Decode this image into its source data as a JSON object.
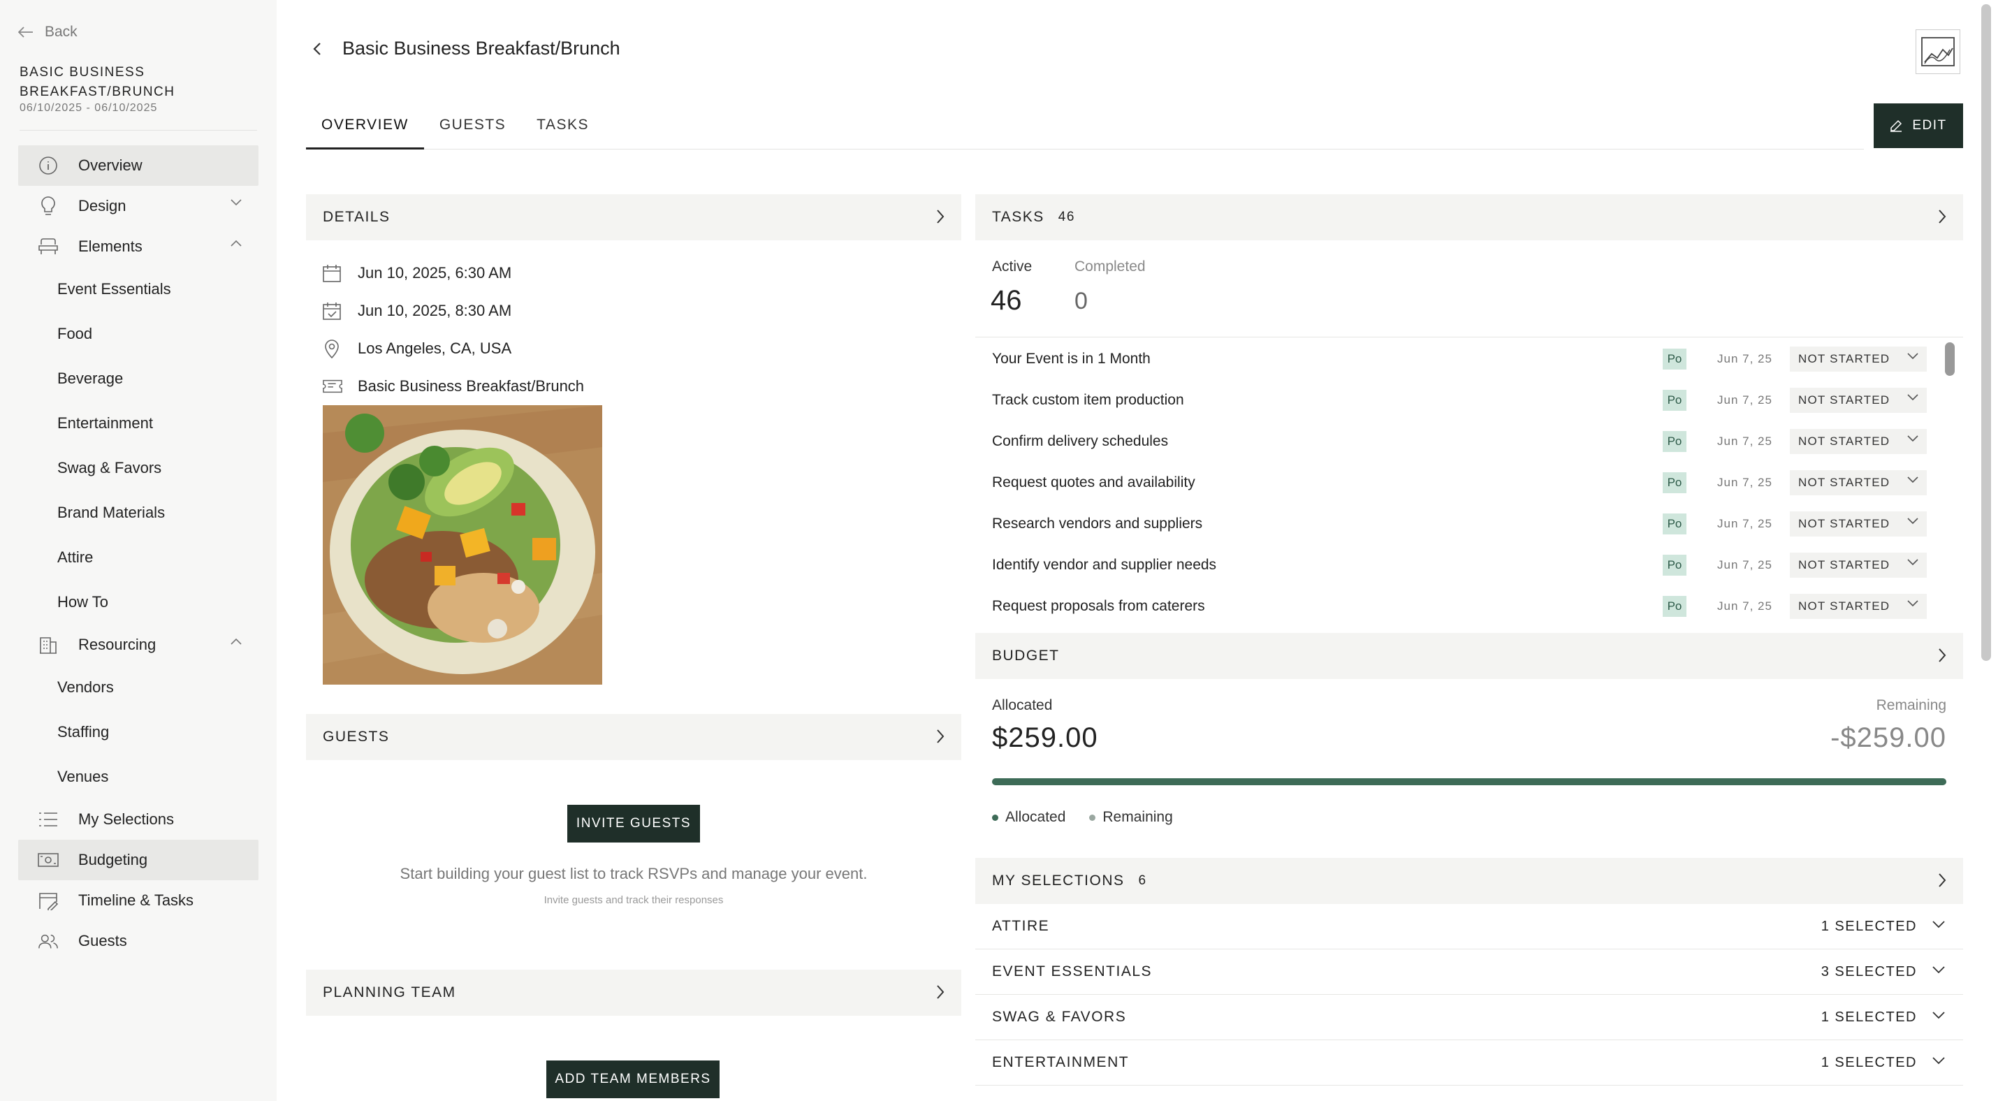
{
  "sidebar": {
    "back_label": "Back",
    "event_title": "BASIC BUSINESS BREAKFAST/BRUNCH",
    "event_dates": "06/10/2025 - 06/10/2025",
    "nav": {
      "overview": "Overview",
      "design": "Design",
      "elements": "Elements",
      "elements_sub": [
        "Event Essentials",
        "Food",
        "Beverage",
        "Entertainment",
        "Swag & Favors",
        "Brand Materials",
        "Attire",
        "How To"
      ],
      "resourcing": "Resourcing",
      "resourcing_sub": [
        "Vendors",
        "Staffing",
        "Venues"
      ],
      "my_selections": "My Selections",
      "budgeting": "Budgeting",
      "timeline": "Timeline & Tasks",
      "guests": "Guests"
    }
  },
  "header": {
    "title": "Basic Business Breakfast/Brunch",
    "tabs": [
      "OVERVIEW",
      "GUESTS",
      "TASKS"
    ],
    "edit_label": "EDIT"
  },
  "details": {
    "heading": "DETAILS",
    "start": "Jun 10, 2025, 6:30 AM",
    "end": "Jun 10, 2025, 8:30 AM",
    "location": "Los Angeles, CA, USA",
    "event_type": "Basic Business Breakfast/Brunch"
  },
  "guests_card": {
    "heading": "GUESTS",
    "button": "INVITE GUESTS",
    "text": "Start building your guest list to track RSVPs and manage your event.",
    "subtext": "Invite guests and track their responses"
  },
  "planning": {
    "heading": "PLANNING TEAM",
    "button": "ADD TEAM MEMBERS"
  },
  "tasks": {
    "heading": "TASKS",
    "count": "46",
    "active_label": "Active",
    "completed_label": "Completed",
    "active_value": "46",
    "completed_value": "0",
    "rows": [
      {
        "name": "Your Event is in 1 Month",
        "assignee": "Po",
        "due": "Jun 7, 25",
        "status": "NOT STARTED"
      },
      {
        "name": "Track custom item production",
        "assignee": "Po",
        "due": "Jun 7, 25",
        "status": "NOT STARTED"
      },
      {
        "name": "Confirm delivery schedules",
        "assignee": "Po",
        "due": "Jun 7, 25",
        "status": "NOT STARTED"
      },
      {
        "name": "Request quotes and availability",
        "assignee": "Po",
        "due": "Jun 7, 25",
        "status": "NOT STARTED"
      },
      {
        "name": "Research vendors and suppliers",
        "assignee": "Po",
        "due": "Jun 7, 25",
        "status": "NOT STARTED"
      },
      {
        "name": "Identify vendor and supplier needs",
        "assignee": "Po",
        "due": "Jun 7, 25",
        "status": "NOT STARTED"
      },
      {
        "name": "Request proposals from caterers",
        "assignee": "Po",
        "due": "Jun 7, 25",
        "status": "NOT STARTED"
      }
    ]
  },
  "budget": {
    "heading": "BUDGET",
    "allocated_label": "Allocated",
    "remaining_label": "Remaining",
    "allocated_value": "$259.00",
    "remaining_value": "-$259.00",
    "allocated_fraction": 1.0,
    "legend_allocated": "Allocated",
    "legend_remaining": "Remaining",
    "colors": {
      "allocated": "#3d6b57",
      "remaining": "#9aa7a0"
    }
  },
  "selections": {
    "heading": "MY SELECTIONS",
    "count": "6",
    "rows": [
      {
        "name": "ATTIRE",
        "value": "1 SELECTED"
      },
      {
        "name": "EVENT ESSENTIALS",
        "value": "3 SELECTED"
      },
      {
        "name": "SWAG & FAVORS",
        "value": "1 SELECTED"
      },
      {
        "name": "ENTERTAINMENT",
        "value": "1 SELECTED"
      }
    ]
  },
  "icons": [
    "arrow-left-icon",
    "info-icon",
    "lightbulb-icon",
    "chair-icon",
    "building-icon",
    "list-icon",
    "money-icon",
    "calendar-edit-icon",
    "users-icon",
    "chevron-left-icon",
    "chart-icon",
    "pencil-icon",
    "calendar-icon",
    "calendar-check-icon",
    "location-pin-icon",
    "ticket-icon",
    "chevron-right-icon",
    "chevron-down-icon"
  ]
}
